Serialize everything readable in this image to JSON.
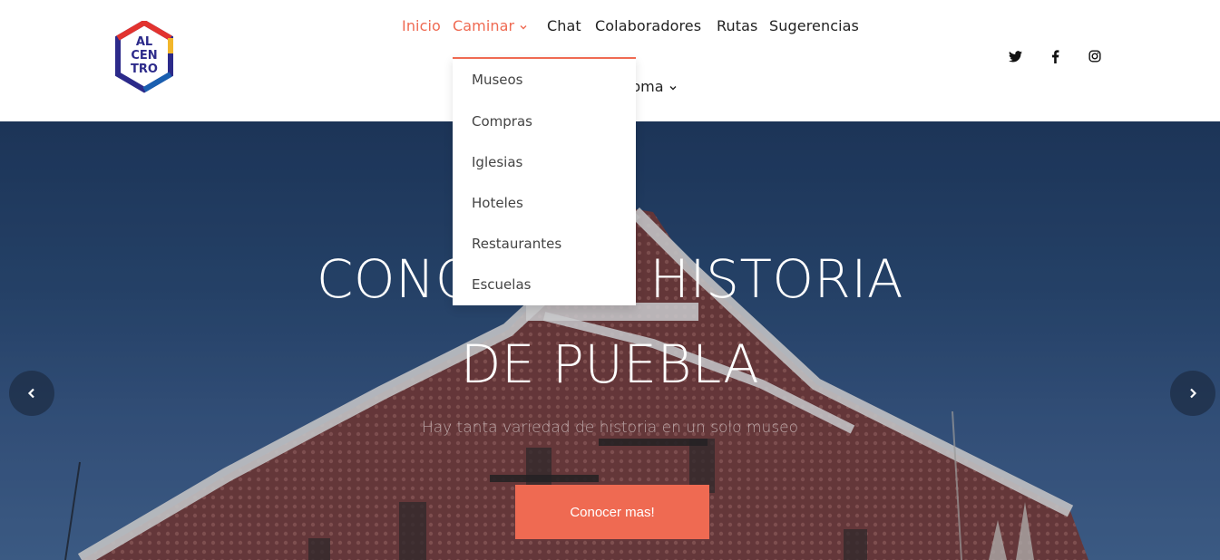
{
  "brand": {
    "logo_lines": [
      "AL",
      "CEN",
      "TRO"
    ],
    "colors": {
      "accent": "#ef6a52",
      "logo_blue": "#2c2a8a",
      "logo_red": "#e2332f",
      "logo_yellow": "#f2b62b"
    }
  },
  "nav": {
    "items": [
      {
        "label": "Inicio",
        "active": true
      },
      {
        "label": "Caminar",
        "active": true,
        "has_dropdown": true
      },
      {
        "label": "Chat"
      },
      {
        "label": "Colaboradores"
      },
      {
        "label": "Rutas"
      },
      {
        "label": "Sugerencias"
      }
    ],
    "idioma_label": "Idioma"
  },
  "dropdown": {
    "items": [
      "Museos",
      "Compras",
      "Iglesias",
      "Hoteles",
      "Restaurantes",
      "Escuelas"
    ]
  },
  "social": {
    "icons": [
      "twitter-icon",
      "facebook-icon",
      "instagram-icon"
    ]
  },
  "hero": {
    "title_line1": "CONOCE LA HISTORIA",
    "title_line2": "DE PUEBLA",
    "subtitle": "Hay tanta variedad de historia en un solo museo",
    "button_label": "Conocer mas!"
  }
}
